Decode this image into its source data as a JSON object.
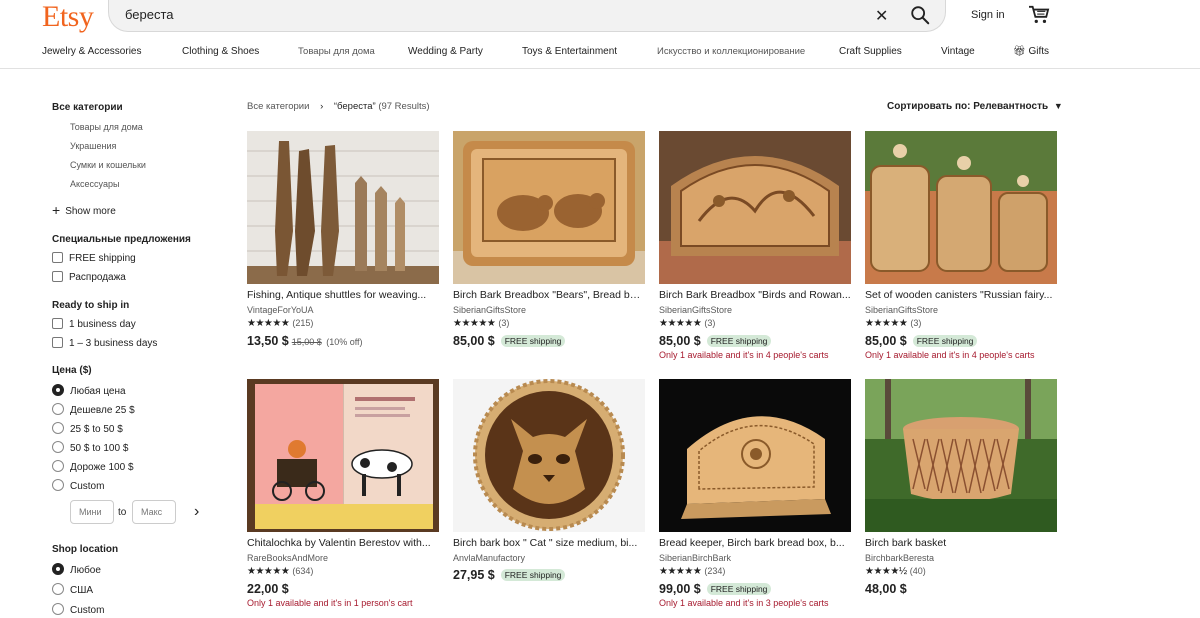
{
  "header": {
    "logo": "Etsy",
    "search_value": "береста",
    "signin": "Sign in"
  },
  "nav": [
    "Jewelry & Accessories",
    "Clothing & Shoes",
    "Товары для дома",
    "Wedding & Party",
    "Toys & Entertainment",
    "Искусство и коллекционирование",
    "Craft Supplies",
    "Vintage",
    "Gifts"
  ],
  "sidebar": {
    "all_categories": "Все категории",
    "categories": [
      "Товары для дома",
      "Украшения",
      "Сумки и кошельки",
      "Аксессуары"
    ],
    "show_more": "Show more",
    "special_title": "Специальные предложения",
    "special": [
      "FREE shipping",
      "Распродажа"
    ],
    "ready_title": "Ready to ship in",
    "ready": [
      "1 business day",
      "1 – 3 business days"
    ],
    "price_title": "Цена ($)",
    "prices": [
      "Любая цена",
      "Дешевле 25 $",
      "25 $ to 50 $",
      "50 $ to 100 $",
      "Дороже 100 $",
      "Custom"
    ],
    "price_min_placeholder": "Мини",
    "price_to": "to",
    "price_max_placeholder": "Макс",
    "location_title": "Shop location",
    "locations": [
      "Любое",
      "США",
      "Custom"
    ]
  },
  "results": {
    "breadcrumb_root": "Все категории",
    "breadcrumb_sep": "›",
    "query": "“береста”",
    "count": "(97 Results)",
    "sort": "Сортировать по: Релевантность"
  },
  "products": [
    {
      "title": "Fishing, Antique shuttles for weaving...",
      "shop": "VintageForYoUA",
      "stars": "★★★★★",
      "reviews": "(215)",
      "price": "13,50 $",
      "orig": "15,00 $",
      "discount": "(10% off)",
      "ship": "",
      "avail": ""
    },
    {
      "title": "Birch Bark Breadbox \"Bears\", Bread box...",
      "shop": "SiberianGiftsStore",
      "stars": "★★★★★",
      "reviews": "(3)",
      "price": "85,00 $",
      "orig": "",
      "discount": "",
      "ship": "FREE shipping",
      "avail": ""
    },
    {
      "title": "Birch Bark Breadbox \"Birds and Rowan...",
      "shop": "SiberianGiftsStore",
      "stars": "★★★★★",
      "reviews": "(3)",
      "price": "85,00 $",
      "orig": "",
      "discount": "",
      "ship": "FREE shipping",
      "avail": "Only 1 available and it's in 4 people's carts"
    },
    {
      "title": "Set of wooden canisters \"Russian fairy...",
      "shop": "SiberianGiftsStore",
      "stars": "★★★★★",
      "reviews": "(3)",
      "price": "85,00 $",
      "orig": "",
      "discount": "",
      "ship": "FREE shipping",
      "avail": "Only 1 available and it's in 4 people's carts"
    },
    {
      "title": "Chitalochka by Valentin Berestov with...",
      "shop": "RareBooksAndMore",
      "stars": "★★★★★",
      "reviews": "(634)",
      "price": "22,00 $",
      "orig": "",
      "discount": "",
      "ship": "",
      "avail": "Only 1 available and it's in 1 person's cart"
    },
    {
      "title": "Birch bark box \" Cat \" size medium, bi...",
      "shop": "AnvlaManufactory",
      "stars": "",
      "reviews": "",
      "price": "27,95 $",
      "orig": "",
      "discount": "",
      "ship": "FREE shipping",
      "avail": ""
    },
    {
      "title": "Bread keeper, Birch bark bread box, b...",
      "shop": "SiberianBirchBark",
      "stars": "★★★★★",
      "reviews": "(234)",
      "price": "99,00 $",
      "orig": "",
      "discount": "",
      "ship": "FREE shipping",
      "avail": "Only 1 available and it's in 3 people's carts"
    },
    {
      "title": "Birch bark basket",
      "shop": "BirchbarkBeresta",
      "stars": "★★★★½",
      "reviews": "(40)",
      "price": "48,00 $",
      "orig": "",
      "discount": "",
      "ship": "",
      "avail": ""
    }
  ],
  "colors": {
    "brand": "#f1641e",
    "free_shipping_bg": "#d4e9d7",
    "availability": "#a61a2e"
  }
}
